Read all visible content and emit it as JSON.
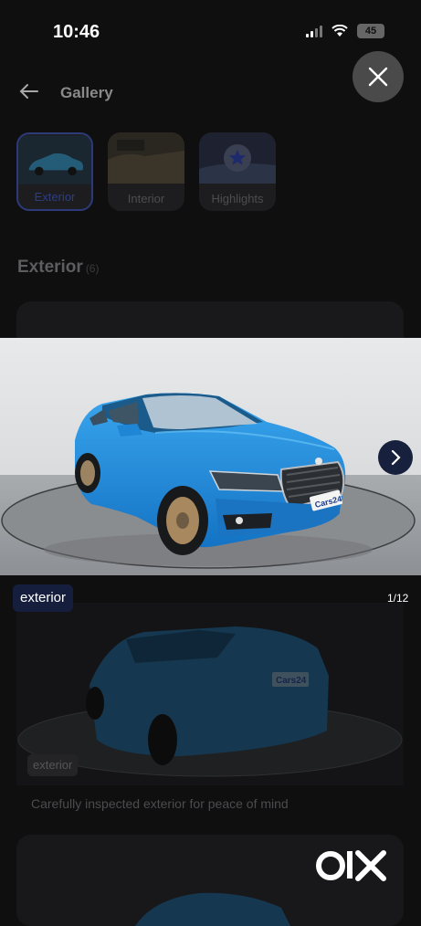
{
  "status": {
    "time": "10:46",
    "battery": "45"
  },
  "header": {
    "title": "Gallery"
  },
  "tabs": [
    {
      "label": "Exterior",
      "active": true
    },
    {
      "label": "Interior",
      "active": false
    },
    {
      "label": "Highlights",
      "active": false
    }
  ],
  "section": {
    "title": "Exterior",
    "count": "(6)"
  },
  "viewer": {
    "category": "exterior",
    "counter": "1/12",
    "plate_text": "Cars24"
  },
  "card": {
    "badge": "exterior",
    "caption": "Carefully inspected exterior for peace of mind"
  },
  "brand": {
    "logo_text": "OLX"
  },
  "colors": {
    "car_blue": "#1f8fe0",
    "accent_navy": "#17203d"
  }
}
